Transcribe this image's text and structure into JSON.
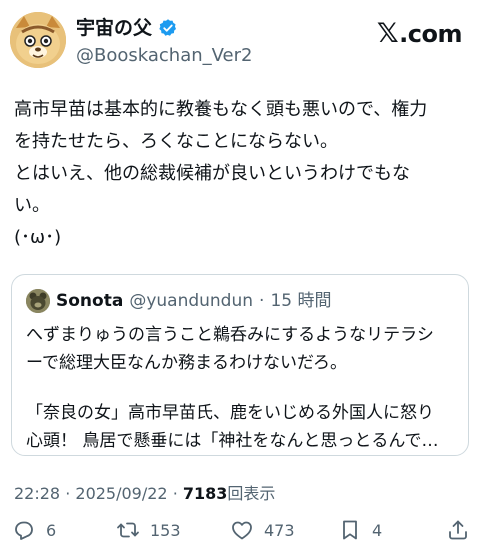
{
  "author": {
    "display_name": "宇宙の父",
    "handle": "@Booskachan_Ver2",
    "verified": true,
    "avatar_icon": "cartoon-animal-avatar"
  },
  "site": {
    "logo_text": ".com",
    "logo_icon": "x-logo-icon"
  },
  "tweet": {
    "lines": [
      "高市早苗は基本的に教養もなく頭も悪いので、権力",
      "を持たせたら、ろくなことにならない。",
      "とはいえ、他の総裁候補が良いというわけでもな",
      "い。",
      "(･ω･)"
    ]
  },
  "quote": {
    "avatar_icon": "user-avatar-icon",
    "display_name": "Sonota",
    "handle": "@yuandundun",
    "separator": "·",
    "time": "15 時間",
    "lines_1": [
      "へずまりゅうの言うこと鵜呑みにするようなリテラシ",
      "ーで総理大臣なんか務まるわけないだろ。"
    ],
    "lines_2": [
      "「奈良の女」高市早苗氏、鹿をいじめる外国人に怒り",
      "心頭！ 鳥居で懸垂には「神社をなんと思っとるんで…"
    ]
  },
  "meta": {
    "time": "22:28",
    "date": "2025/09/22",
    "separator": "·",
    "views": "7183",
    "views_label": "回表示"
  },
  "actions": {
    "reply_count": "6",
    "repost_count": "153",
    "like_count": "473",
    "bookmark_count": "4"
  },
  "colors": {
    "text_primary": "#0f1419",
    "text_secondary": "#536471",
    "verified_blue": "#1d9bf0",
    "border": "#cfd9de"
  }
}
